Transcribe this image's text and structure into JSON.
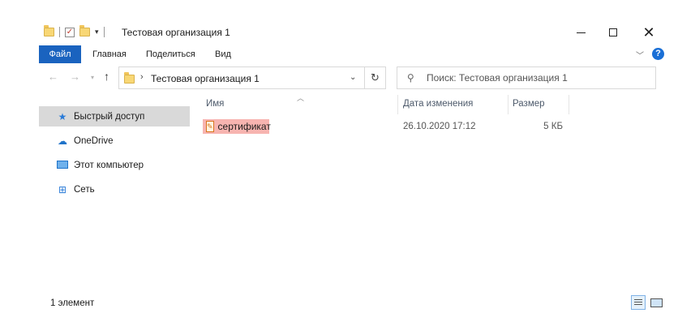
{
  "window": {
    "title": "Тестовая организация 1"
  },
  "ribbon": {
    "tabs": [
      {
        "label": "Файл"
      },
      {
        "label": "Главная"
      },
      {
        "label": "Поделиться"
      },
      {
        "label": "Вид"
      }
    ],
    "help_label": "?"
  },
  "navigation": {
    "address_path": "Тестовая организация 1",
    "search_placeholder": "Поиск: Тестовая организация 1"
  },
  "sidebar": {
    "items": [
      {
        "label": "Быстрый доступ",
        "icon": "star-icon",
        "selected": true
      },
      {
        "label": "OneDrive",
        "icon": "cloud-icon"
      },
      {
        "label": "Этот компьютер",
        "icon": "computer-icon"
      },
      {
        "label": "Сеть",
        "icon": "network-icon"
      }
    ]
  },
  "columns": {
    "name": "Имя",
    "date": "Дата изменения",
    "size": "Размер"
  },
  "files": [
    {
      "name": "сертификат",
      "date": "26.10.2020 17:12",
      "size": "5 КБ",
      "icon": "certificate-icon"
    }
  ],
  "status": {
    "item_count": "1 элемент"
  },
  "colors": {
    "file_tab": "#1a63bf",
    "selected_nav": "#d9d9d9",
    "file_highlight": "#f7b4b0",
    "help": "#1a6fd6"
  }
}
